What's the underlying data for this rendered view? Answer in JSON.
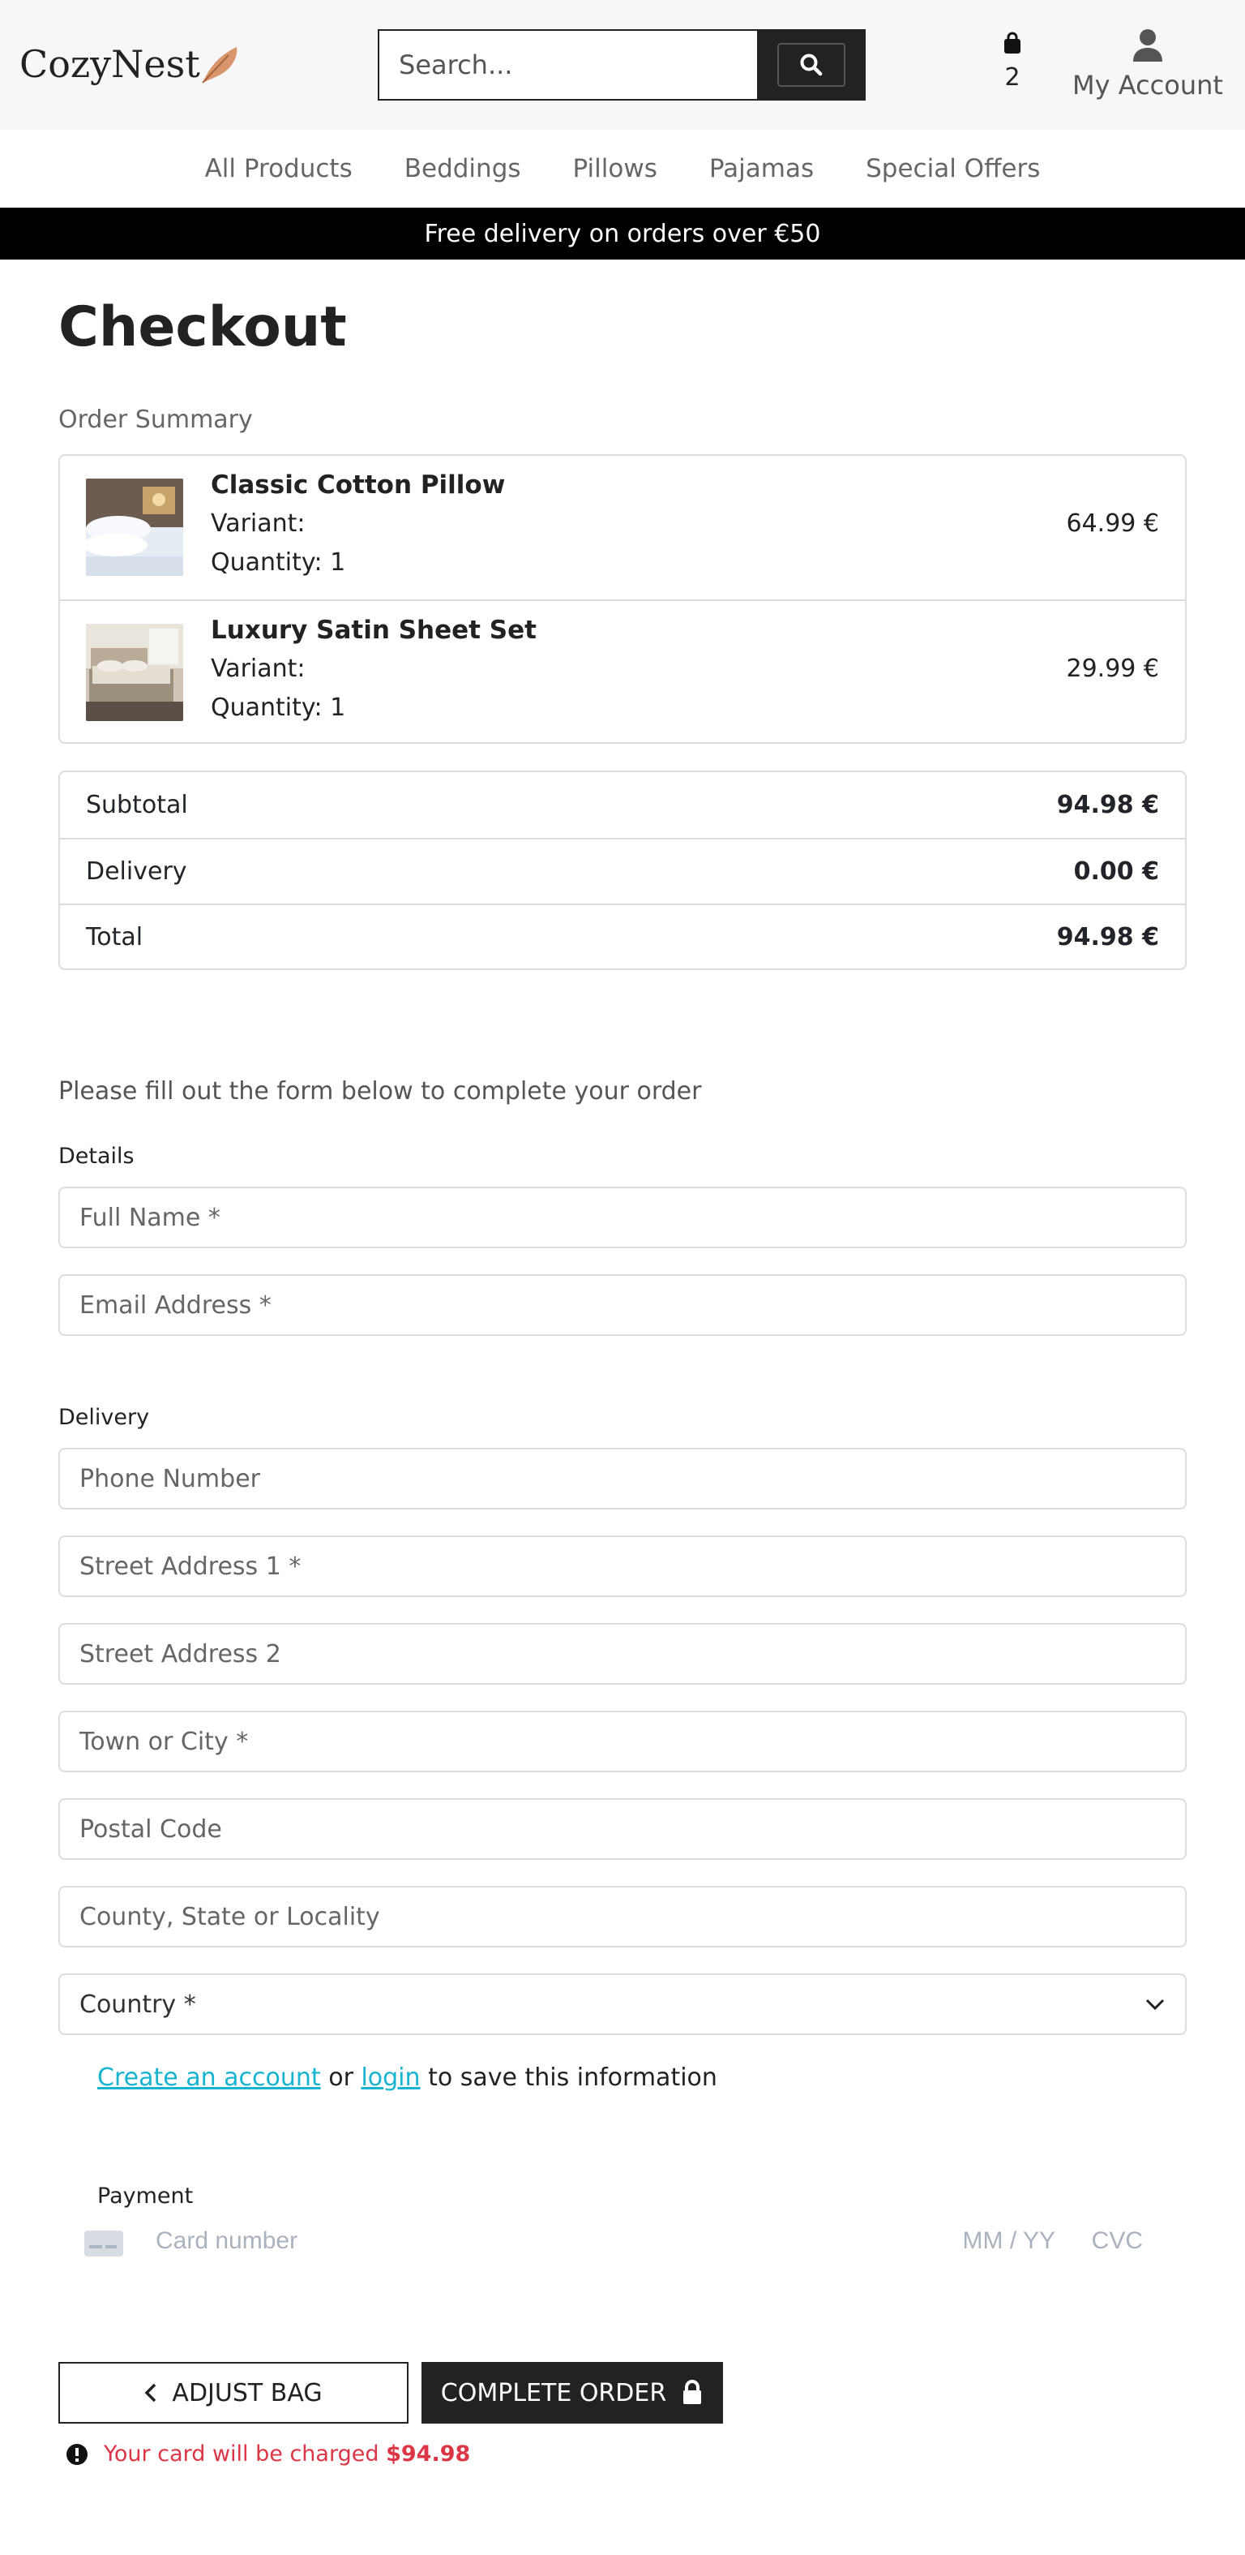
{
  "header": {
    "logo": "CozyNest",
    "search_placeholder": "Search...",
    "bag_count": "2",
    "account_label": "My Account"
  },
  "nav": [
    "All Products",
    "Beddings",
    "Pillows",
    "Pajamas",
    "Special Offers"
  ],
  "banner": "Free delivery on orders over €50",
  "page": {
    "title": "Checkout",
    "order_summary_label": "Order Summary"
  },
  "items": [
    {
      "name": "Classic Cotton Pillow",
      "variant": "Variant:",
      "quantity": "Quantity: 1",
      "price": "64.99 €"
    },
    {
      "name": "Luxury Satin Sheet Set",
      "variant": "Variant:",
      "quantity": "Quantity: 1",
      "price": "29.99 €"
    }
  ],
  "totals": [
    {
      "label": "Subtotal",
      "value": "94.98 €"
    },
    {
      "label": "Delivery",
      "value": "0.00 €"
    },
    {
      "label": "Total",
      "value": "94.98 €"
    }
  ],
  "form": {
    "intro": "Please fill out the form below to complete your order",
    "details_label": "Details",
    "full_name_placeholder": "Full Name *",
    "email_placeholder": "Email Address *",
    "delivery_label": "Delivery",
    "phone_placeholder": "Phone Number",
    "street1_placeholder": "Street Address 1 *",
    "street2_placeholder": "Street Address 2",
    "town_placeholder": "Town or City *",
    "postal_placeholder": "Postal Code",
    "county_placeholder": "County, State or Locality",
    "country_value": "Country *",
    "save_create": "Create an account",
    "save_or": " or ",
    "save_login": "login",
    "save_rest": " to save this information",
    "payment_label": "Payment",
    "card_number_placeholder": "Card number",
    "card_exp_placeholder": "MM / YY",
    "card_cvc_placeholder": "CVC"
  },
  "actions": {
    "adjust_bag": "ADJUST BAG",
    "complete_order": "COMPLETE ORDER",
    "charge_text": "Your card will be charged",
    "charge_amount": "$94.98"
  },
  "colors": {
    "accent_link": "#17b3d0",
    "danger": "#dc3545",
    "dark": "#222222"
  }
}
